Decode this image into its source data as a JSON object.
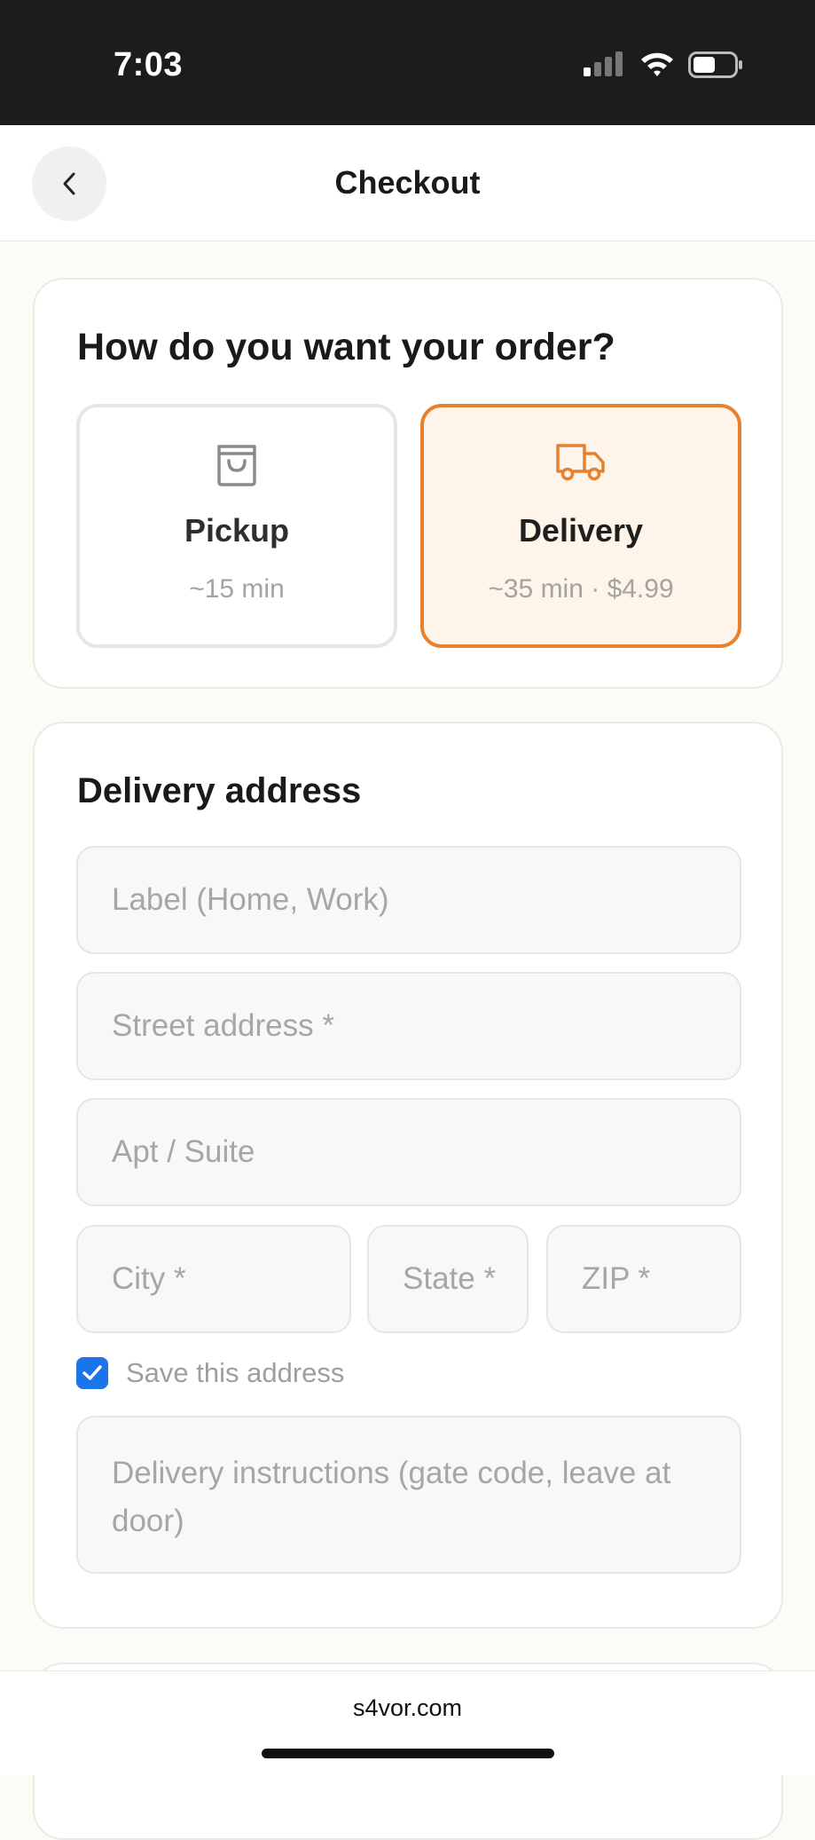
{
  "status_bar": {
    "time": "7:03"
  },
  "header": {
    "title": "Checkout"
  },
  "order_type": {
    "heading": "How do you want your order?",
    "options": [
      {
        "label": "Pickup",
        "detail": "~15 min",
        "icon": "shopping-bag-icon",
        "selected": false
      },
      {
        "label": "Delivery",
        "detail": "~35 min · $4.99",
        "icon": "truck-icon",
        "selected": true
      }
    ],
    "accent_color": "#e5812f"
  },
  "delivery_address": {
    "heading": "Delivery address",
    "fields": {
      "label": {
        "placeholder": "Label (Home, Work)",
        "value": ""
      },
      "street": {
        "placeholder": "Street address *",
        "value": ""
      },
      "apt": {
        "placeholder": "Apt / Suite",
        "value": ""
      },
      "city": {
        "placeholder": "City *",
        "value": ""
      },
      "state": {
        "placeholder": "State *",
        "value": ""
      },
      "zip": {
        "placeholder": "ZIP *",
        "value": ""
      },
      "instructions": {
        "placeholder": "Delivery instructions (gate code, leave at door)",
        "value": ""
      }
    },
    "save_address": {
      "label": "Save this address",
      "checked": true
    }
  },
  "footer": {
    "url": "s4vor.com"
  }
}
